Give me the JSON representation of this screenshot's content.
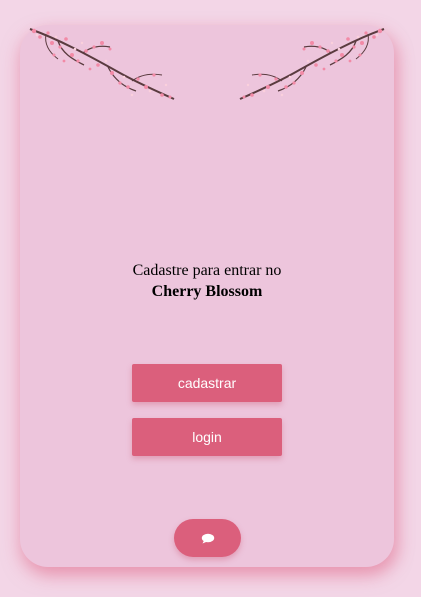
{
  "welcome": {
    "line1": "Cadastre para entrar no",
    "brand": "Cherry Blossom"
  },
  "buttons": {
    "register_label": "cadastrar",
    "login_label": "login"
  },
  "chat": {
    "icon": "chat-bubble-icon"
  },
  "colors": {
    "page_background": "#f3d6e7",
    "card_background": "#edc5dc",
    "accent": "#db5f7c",
    "button_text": "#ffffff"
  }
}
